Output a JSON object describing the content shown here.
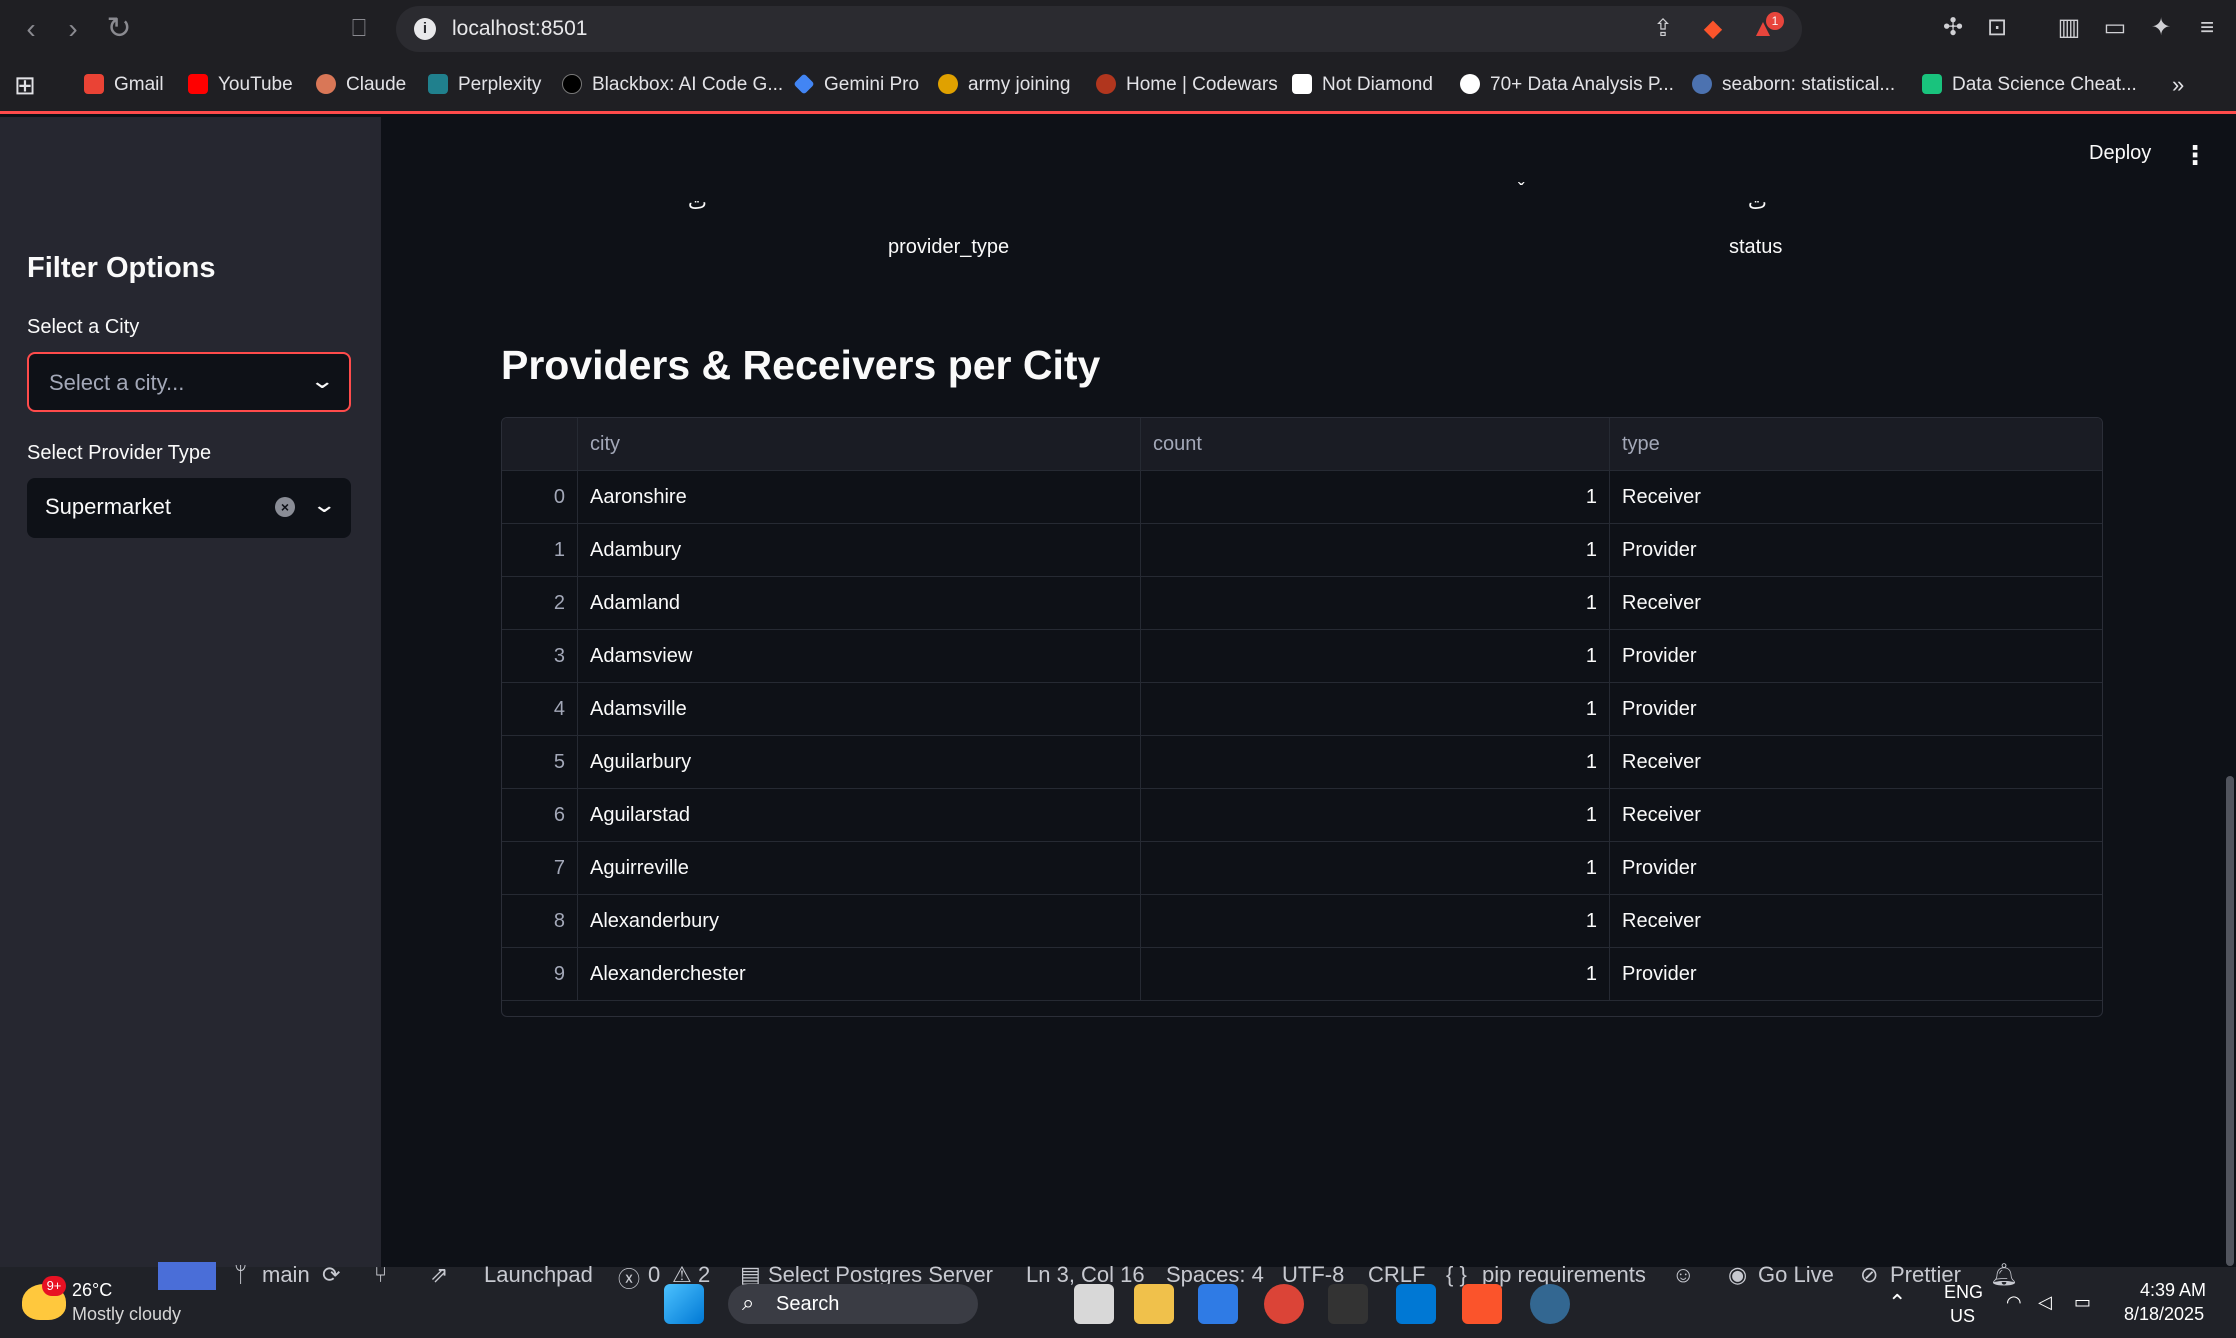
{
  "browser": {
    "url": "localhost:8501",
    "notification_count": "1",
    "bookmarks": [
      {
        "label": "Gmail",
        "color": "#ea4335"
      },
      {
        "label": "YouTube",
        "color": "#ff0000"
      },
      {
        "label": "Claude",
        "color": "#d97757"
      },
      {
        "label": "Perplexity",
        "color": "#20808d"
      },
      {
        "label": "Blackbox: AI Code G...",
        "color": "#000000"
      },
      {
        "label": "Gemini Pro",
        "color": "#4285f4"
      },
      {
        "label": "army joining",
        "color": "#e0a100"
      },
      {
        "label": "Home | Codewars",
        "color": "#b1361e"
      },
      {
        "label": "Not Diamond",
        "color": "#ffffff"
      },
      {
        "label": "70+ Data Analysis P...",
        "color": "#ffffff"
      },
      {
        "label": "seaborn: statistical...",
        "color": "#4c72b0"
      },
      {
        "label": "Data Science Cheat...",
        "color": "#19c37d"
      }
    ]
  },
  "app": {
    "deploy_label": "Deploy",
    "chart_axis": {
      "left": "provider_type",
      "right": "status"
    },
    "sidebar": {
      "title": "Filter Options",
      "city_label": "Select a City",
      "city_placeholder": "Select a city...",
      "provider_label": "Select Provider Type",
      "provider_value": "Supermarket"
    },
    "section_title": "Providers & Receivers per City",
    "table": {
      "columns": [
        "city",
        "count",
        "type"
      ],
      "rows": [
        {
          "idx": "0",
          "city": "Aaronshire",
          "count": "1",
          "type": "Receiver"
        },
        {
          "idx": "1",
          "city": "Adambury",
          "count": "1",
          "type": "Provider"
        },
        {
          "idx": "2",
          "city": "Adamland",
          "count": "1",
          "type": "Receiver"
        },
        {
          "idx": "3",
          "city": "Adamsview",
          "count": "1",
          "type": "Provider"
        },
        {
          "idx": "4",
          "city": "Adamsville",
          "count": "1",
          "type": "Provider"
        },
        {
          "idx": "5",
          "city": "Aguilarbury",
          "count": "1",
          "type": "Receiver"
        },
        {
          "idx": "6",
          "city": "Aguilarstad",
          "count": "1",
          "type": "Receiver"
        },
        {
          "idx": "7",
          "city": "Aguirreville",
          "count": "1",
          "type": "Provider"
        },
        {
          "idx": "8",
          "city": "Alexanderbury",
          "count": "1",
          "type": "Receiver"
        },
        {
          "idx": "9",
          "city": "Alexanderchester",
          "count": "1",
          "type": "Provider"
        }
      ]
    }
  },
  "vscode_status": {
    "branch": "main",
    "launchpad": "Launchpad",
    "errors": "0",
    "warnings": "2",
    "postgres": "Select Postgres Server",
    "position": "Ln 3, Col 16",
    "spaces": "Spaces: 4",
    "encoding": "UTF-8",
    "eol": "CRLF",
    "language": "pip requirements",
    "go_live": "Go Live",
    "prettier": "Prettier"
  },
  "taskbar": {
    "weather_badge": "9+",
    "temperature": "26°C",
    "weather": "Mostly cloudy",
    "search_label": "Search",
    "lang_top": "ENG",
    "lang_bottom": "US",
    "time": "4:39 AM",
    "date": "8/18/2025"
  }
}
